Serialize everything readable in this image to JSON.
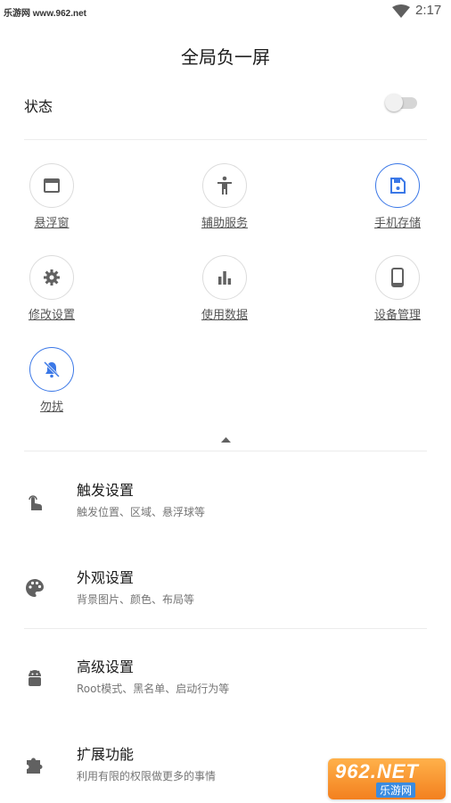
{
  "statusbar": {
    "watermark": "乐游网 www.962.net",
    "time": "2:17"
  },
  "page": {
    "title": "全局负一屏"
  },
  "status": {
    "label": "状态",
    "toggle_on": false
  },
  "tiles": [
    {
      "label": "悬浮窗",
      "icon": "window-icon",
      "active": false
    },
    {
      "label": "辅助服务",
      "icon": "accessibility-icon",
      "active": false
    },
    {
      "label": "手机存储",
      "icon": "save-icon",
      "active": true
    },
    {
      "label": "修改设置",
      "icon": "gear-icon",
      "active": false
    },
    {
      "label": "使用数据",
      "icon": "bar-chart-icon",
      "active": false
    },
    {
      "label": "设备管理",
      "icon": "phone-icon",
      "active": false
    },
    {
      "label": "勿扰",
      "icon": "bell-off-icon",
      "active": true
    }
  ],
  "settings": [
    {
      "title": "触发设置",
      "subtitle": "触发位置、区域、悬浮球等",
      "icon": "touch-icon"
    },
    {
      "title": "外观设置",
      "subtitle": "背景图片、颜色、布局等",
      "icon": "palette-icon"
    },
    {
      "title": "高级设置",
      "subtitle": "Root模式、黑名单、启动行为等",
      "icon": "android-icon"
    },
    {
      "title": "扩展功能",
      "subtitle": "利用有限的权限做更多的事情",
      "icon": "puzzle-icon"
    }
  ],
  "watermark_bottom": {
    "big": "962.NET",
    "small": "乐游网"
  },
  "colors": {
    "accent": "#3b78e7",
    "icon_gray": "#616161"
  }
}
